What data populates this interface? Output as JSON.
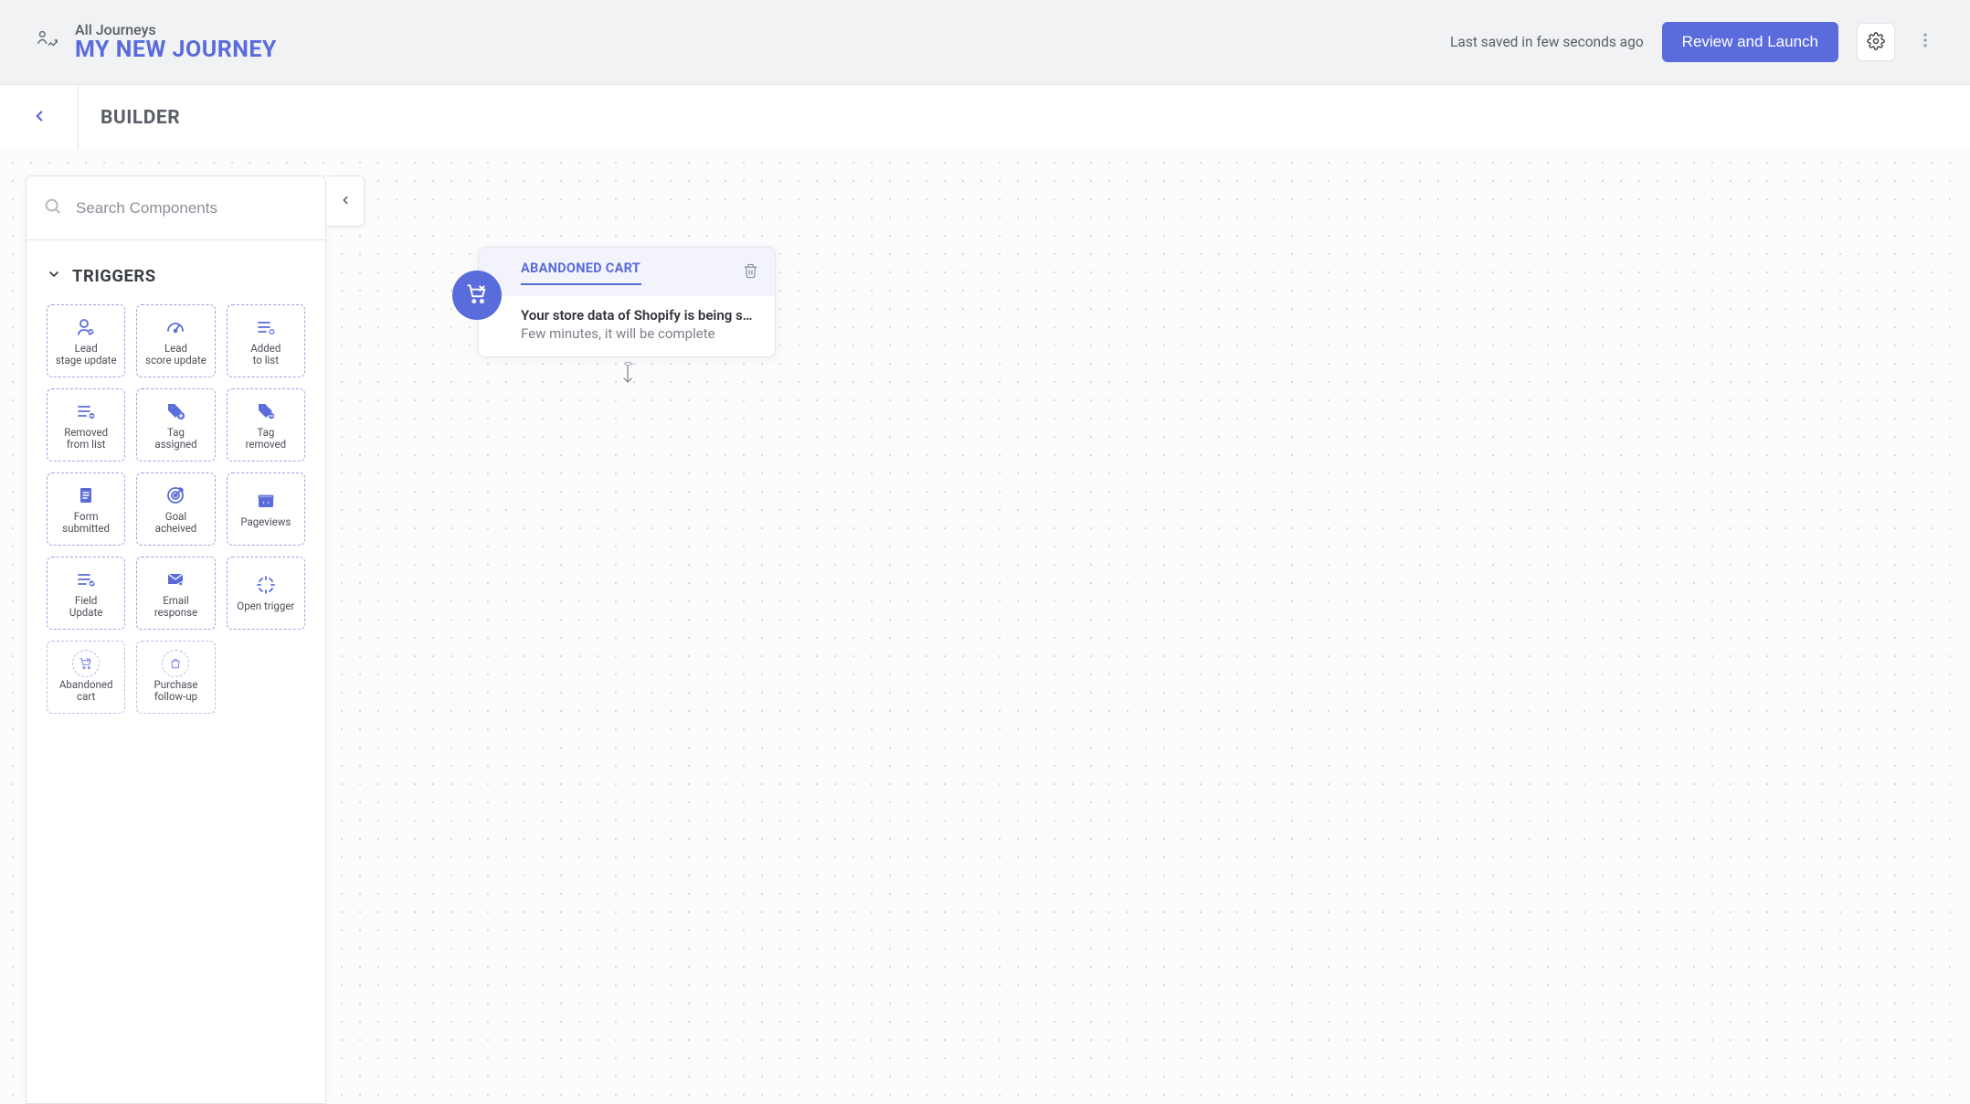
{
  "header": {
    "breadcrumb": "All Journeys",
    "title": "MY NEW JOURNEY",
    "saved_text": "Last saved in few seconds ago",
    "review_button": "Review and Launch"
  },
  "subbar": {
    "title": "BUILDER"
  },
  "panel": {
    "search_placeholder": "Search Components",
    "section_title": "TRIGGERS",
    "tiles": [
      {
        "id": "lead-stage-update",
        "label": "Lead\nstage update"
      },
      {
        "id": "lead-score-update",
        "label": "Lead\nscore update"
      },
      {
        "id": "added-to-list",
        "label": "Added\nto list"
      },
      {
        "id": "removed-from-list",
        "label": "Removed\nfrom list"
      },
      {
        "id": "tag-assigned",
        "label": "Tag\nassigned"
      },
      {
        "id": "tag-removed",
        "label": "Tag\nremoved"
      },
      {
        "id": "form-submitted",
        "label": "Form\nsubmitted"
      },
      {
        "id": "goal-achieved",
        "label": "Goal\nacheived"
      },
      {
        "id": "pageviews",
        "label": "Pageviews"
      },
      {
        "id": "field-update",
        "label": "Field\nUpdate"
      },
      {
        "id": "email-response",
        "label": "Email\nresponse"
      },
      {
        "id": "open-trigger",
        "label": "Open trigger"
      },
      {
        "id": "abandoned-cart",
        "label": "Abandoned\ncart"
      },
      {
        "id": "purchase-follow-up",
        "label": "Purchase\nfollow-up"
      }
    ]
  },
  "canvas": {
    "node": {
      "title": "ABANDONED CART",
      "msg1": "Your store data of Shopify is being synce…",
      "msg2": "Few minutes, it will be complete"
    }
  }
}
